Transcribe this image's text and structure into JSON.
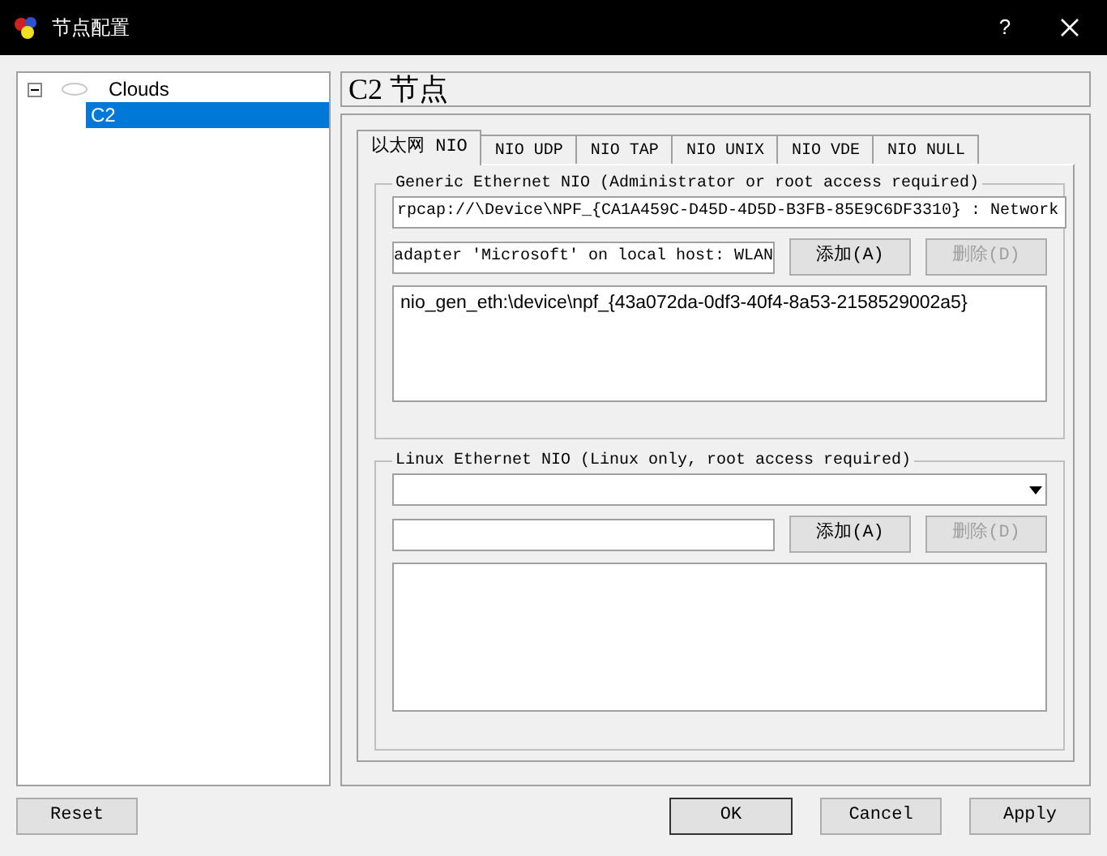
{
  "window": {
    "title": "节点配置",
    "help": "?"
  },
  "tree": [
    {
      "label": "Clouds",
      "expanded": true,
      "selected": false,
      "children": [
        {
          "label": "C2",
          "selected": true
        }
      ]
    }
  ],
  "header": "C2 节点",
  "tabs": [
    {
      "label": "以太网 NIO",
      "selected": true
    },
    {
      "label": "NIO UDP",
      "selected": false
    },
    {
      "label": "NIO TAP",
      "selected": false
    },
    {
      "label": "NIO UNIX",
      "selected": false
    },
    {
      "label": "NIO VDE",
      "selected": false
    },
    {
      "label": "NIO NULL",
      "selected": false
    }
  ],
  "generic": {
    "legend": "Generic Ethernet NIO (Administrator or root access required)",
    "device": "rpcap://\\Device\\NPF_{CA1A459C-D45D-4D5D-B3FB-85E9C6DF3310} : Network",
    "name": "adapter 'Microsoft' on local host: WLAN",
    "add": {
      "label": "添加(A)",
      "disabled": false
    },
    "delete": {
      "label": "删除(D)",
      "disabled": true
    },
    "list": [
      "nio_gen_eth:\\device\\npf_{43a072da-0df3-40f4-8a53-2158529002a5}"
    ]
  },
  "linux": {
    "legend": "Linux Ethernet NIO (Linux only, root access required)",
    "add": {
      "label": "添加(A)",
      "disabled": false
    },
    "delete": {
      "label": "删除(D)",
      "disabled": true
    }
  },
  "footer": [
    {
      "label": "Reset",
      "default": false
    },
    {
      "label": "OK",
      "default": true
    },
    {
      "label": "Cancel",
      "default": false
    },
    {
      "label": "Apply",
      "default": false
    }
  ]
}
